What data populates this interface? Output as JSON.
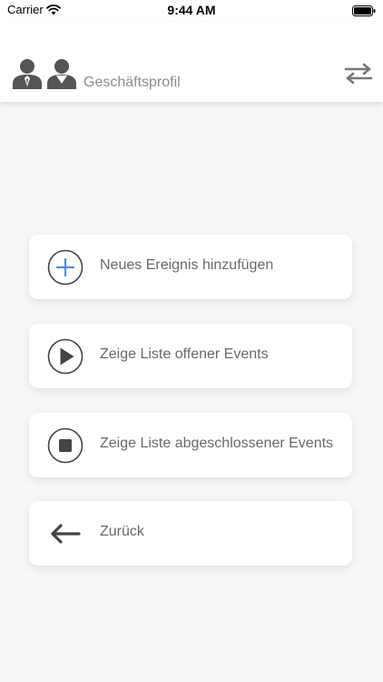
{
  "status_bar": {
    "carrier": "Carrier",
    "time": "9:44 AM"
  },
  "header": {
    "title": "Geschäftsprofil",
    "icons": [
      "business-profile-icon",
      "swap-arrows-icon"
    ]
  },
  "menu": {
    "items": [
      {
        "label": "Neues Ereignis hinzufügen",
        "icon": "plus-circle-icon"
      },
      {
        "label": "Zeige Liste offener Events",
        "icon": "play-circle-icon"
      },
      {
        "label": "Zeige Liste abgeschlossener Events",
        "icon": "stop-circle-icon"
      },
      {
        "label": "Zurück",
        "icon": "arrow-left-icon"
      }
    ]
  },
  "colors": {
    "background": "#f7f7f7",
    "card": "#ffffff",
    "label": "#6a6a6a",
    "accent_plus": "#4a90e2",
    "icon_dark": "#444444"
  }
}
